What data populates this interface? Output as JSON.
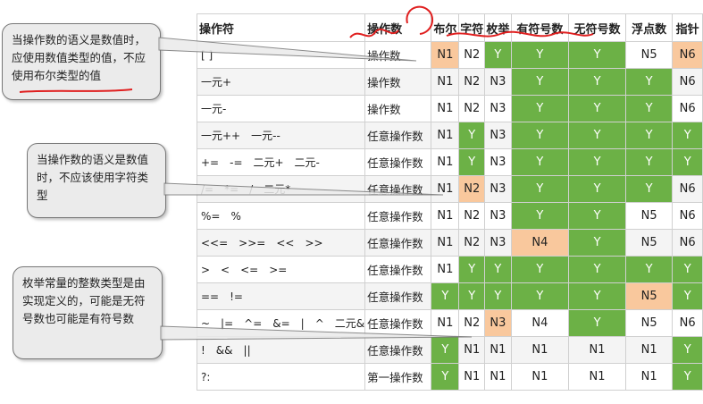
{
  "headers": [
    "操作符",
    "操作数",
    "布尔",
    "字符",
    "枚举",
    "有符号数",
    "无符号数",
    "浮点数",
    "指针"
  ],
  "rows": [
    {
      "op": "[ ]",
      "kind": "操作数",
      "cells": [
        "N1",
        "N2",
        "Y",
        "Y",
        "Y",
        "N5",
        "N6"
      ]
    },
    {
      "op": "一元+",
      "kind": "操作数",
      "cells": [
        "N1",
        "N2",
        "N3",
        "Y",
        "Y",
        "Y",
        "N6"
      ]
    },
    {
      "op": "一元-",
      "kind": "操作数",
      "cells": [
        "N1",
        "N2",
        "N3",
        "Y",
        "Y",
        "Y",
        "N6"
      ]
    },
    {
      "op": "一元++　一元--",
      "kind": "任意操作数",
      "cells": [
        "N1",
        "Y",
        "N3",
        "Y",
        "Y",
        "Y",
        "Y"
      ]
    },
    {
      "op": "+=　-=　二元+　二元-",
      "kind": "任意操作数",
      "cells": [
        "N1",
        "Y",
        "N3",
        "Y",
        "Y",
        "Y",
        "Y"
      ]
    },
    {
      "op": "/=　*=　/　二元*",
      "kind": "任意操作数",
      "cells": [
        "N1",
        "N2",
        "N3",
        "Y",
        "Y",
        "Y",
        "N6"
      ]
    },
    {
      "op": "%=　%",
      "kind": "任意操作数",
      "cells": [
        "N1",
        "N2",
        "N3",
        "Y",
        "Y",
        "N5",
        "N6"
      ]
    },
    {
      "op": "<<=　>>=　<<　>>",
      "kind": "任意操作数",
      "cells": [
        "N1",
        "N2",
        "N3",
        "N4",
        "Y",
        "N5",
        "N6"
      ]
    },
    {
      "op": ">　<　<=　>=",
      "kind": "任意操作数",
      "cells": [
        "N1",
        "Y",
        "Y",
        "Y",
        "Y",
        "Y",
        "Y"
      ]
    },
    {
      "op": "==　!=",
      "kind": "任意操作数",
      "cells": [
        "Y",
        "Y",
        "Y",
        "Y",
        "Y",
        "N5",
        "Y"
      ]
    },
    {
      "op": "~　|=　^=　&=　|　^　二元&",
      "kind": "任意操作数",
      "cells": [
        "N1",
        "N2",
        "N3",
        "N4",
        "Y",
        "N5",
        "N6"
      ]
    },
    {
      "op": "!　&&　||",
      "kind": "任意操作数",
      "cells": [
        "Y",
        "N1",
        "N1",
        "N1",
        "N1",
        "N1",
        "Y"
      ]
    },
    {
      "op": "?:",
      "kind": "第一操作数",
      "cells": [
        "Y",
        "N1",
        "N1",
        "N1",
        "N1",
        "N1",
        "Y"
      ]
    }
  ],
  "highlights": {
    "orange_cells": [
      [
        0,
        0
      ],
      [
        0,
        6
      ],
      [
        5,
        1
      ],
      [
        7,
        3
      ],
      [
        9,
        5
      ],
      [
        10,
        2
      ]
    ]
  },
  "callouts": {
    "c1": "当操作数的语义是数值时，应使用数值类型的值，不应使用布尔类型的值",
    "c2": "当操作数的语义是数值时，不应该使用字符类型",
    "c3": "枚举常量的整数类型是由实现定义的，可能是无符号数也可能是有符号数"
  },
  "colors": {
    "yes_green": "#6cb146",
    "flag_orange": "#f9c89d",
    "annotation_red": "#e02020"
  }
}
